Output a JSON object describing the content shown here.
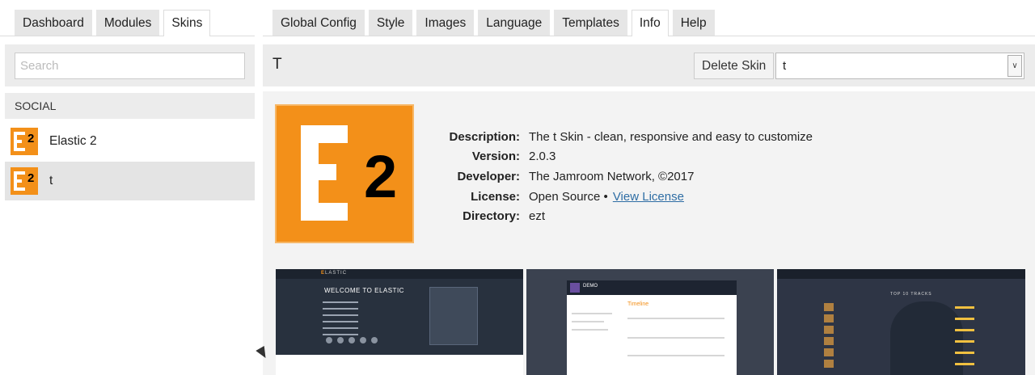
{
  "left_tabs": [
    "Dashboard",
    "Modules",
    "Skins"
  ],
  "right_tabs": [
    "Global Config",
    "Style",
    "Images",
    "Language",
    "Templates",
    "Info",
    "Help"
  ],
  "active_left_tab": "Skins",
  "active_right_tab": "Info",
  "sidebar": {
    "search_placeholder": "Search",
    "section_title": "SOCIAL",
    "items": [
      {
        "name": "Elastic 2",
        "icon": "e2-logo-icon",
        "selected": false
      },
      {
        "name": "t",
        "icon": "e2-logo-icon",
        "selected": true
      }
    ]
  },
  "main": {
    "title": "T",
    "delete_button": "Delete Skin",
    "skin_select_value": "t",
    "logo_text": "2",
    "details": [
      {
        "key": "Description:",
        "value": "The t Skin - clean, responsive and easy to customize"
      },
      {
        "key": "Version:",
        "value": "2.0.3"
      },
      {
        "key": "Developer:",
        "value": "The Jamroom Network, ©2017"
      },
      {
        "key": "License:",
        "value": "Open Source  •"
      },
      {
        "key": "Directory:",
        "value": "ezt"
      }
    ],
    "license_link": "View License",
    "screenshots": {
      "shot1_logo": "LASTIC",
      "shot1_heading": "WELCOME TO ELASTIC",
      "shot2_title": "DEMO",
      "shot2_section": "Timeline",
      "shot3_title": "TOP 10 TRACKS"
    }
  },
  "colors": {
    "accent": "#f39019",
    "link": "#2e6da4",
    "panel": "#ececec"
  }
}
